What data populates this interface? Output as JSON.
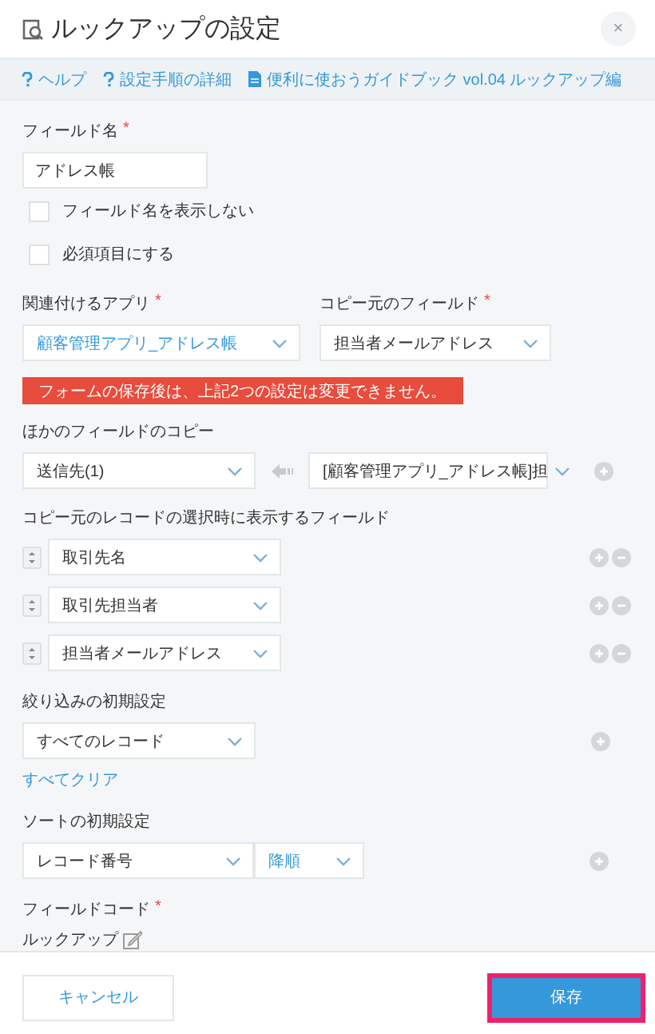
{
  "dialog": {
    "title": "ルックアップの設定",
    "close": "×"
  },
  "help_links": [
    {
      "kind": "help",
      "label": "ヘルプ"
    },
    {
      "kind": "help",
      "label": "設定手順の詳細"
    },
    {
      "kind": "document",
      "label": "便利に使おうガイドブック vol.04 ルックアップ編"
    }
  ],
  "field_name": {
    "label": "フィールド名",
    "required_mark": "*",
    "value": "アドレス帳"
  },
  "checkboxes": [
    {
      "label": "フィールド名を表示しない",
      "checked": false
    },
    {
      "label": "必須項目にする",
      "checked": false
    }
  ],
  "related_app": {
    "label": "関連付けるアプリ",
    "required_mark": "*",
    "value": "顧客管理アプリ_アドレス帳",
    "accent": true
  },
  "source_field": {
    "label": "コピー元のフィールド",
    "required_mark": "*",
    "value": "担当者メールアドレス",
    "accent": false
  },
  "warning": "フォームの保存後は、上記2つの設定は変更できません。",
  "field_mappings": {
    "label": "ほかのフィールドのコピー",
    "rows": [
      {
        "target": "送信先(1)",
        "source": "[顧客管理アプリ_アドレス帳]担"
      }
    ]
  },
  "display_fields": {
    "label": "コピー元のレコードの選択時に表示するフィールド",
    "rows": [
      {
        "value": "取引先名"
      },
      {
        "value": "取引先担当者"
      },
      {
        "value": "担当者メールアドレス"
      }
    ]
  },
  "filter": {
    "label": "絞り込みの初期設定",
    "value": "すべてのレコード",
    "clear_link": "すべてクリア"
  },
  "sort": {
    "label": "ソートの初期設定",
    "field": "レコード番号",
    "order": "降順",
    "order_accent": true
  },
  "field_code": {
    "label": "フィールドコード",
    "required_mark": "*",
    "value": "ルックアップ"
  },
  "buttons": [
    {
      "kind": "cancel",
      "label": "キャンセル",
      "highlighted": false
    },
    {
      "kind": "save",
      "label": "保存",
      "highlighted": true
    }
  ]
}
